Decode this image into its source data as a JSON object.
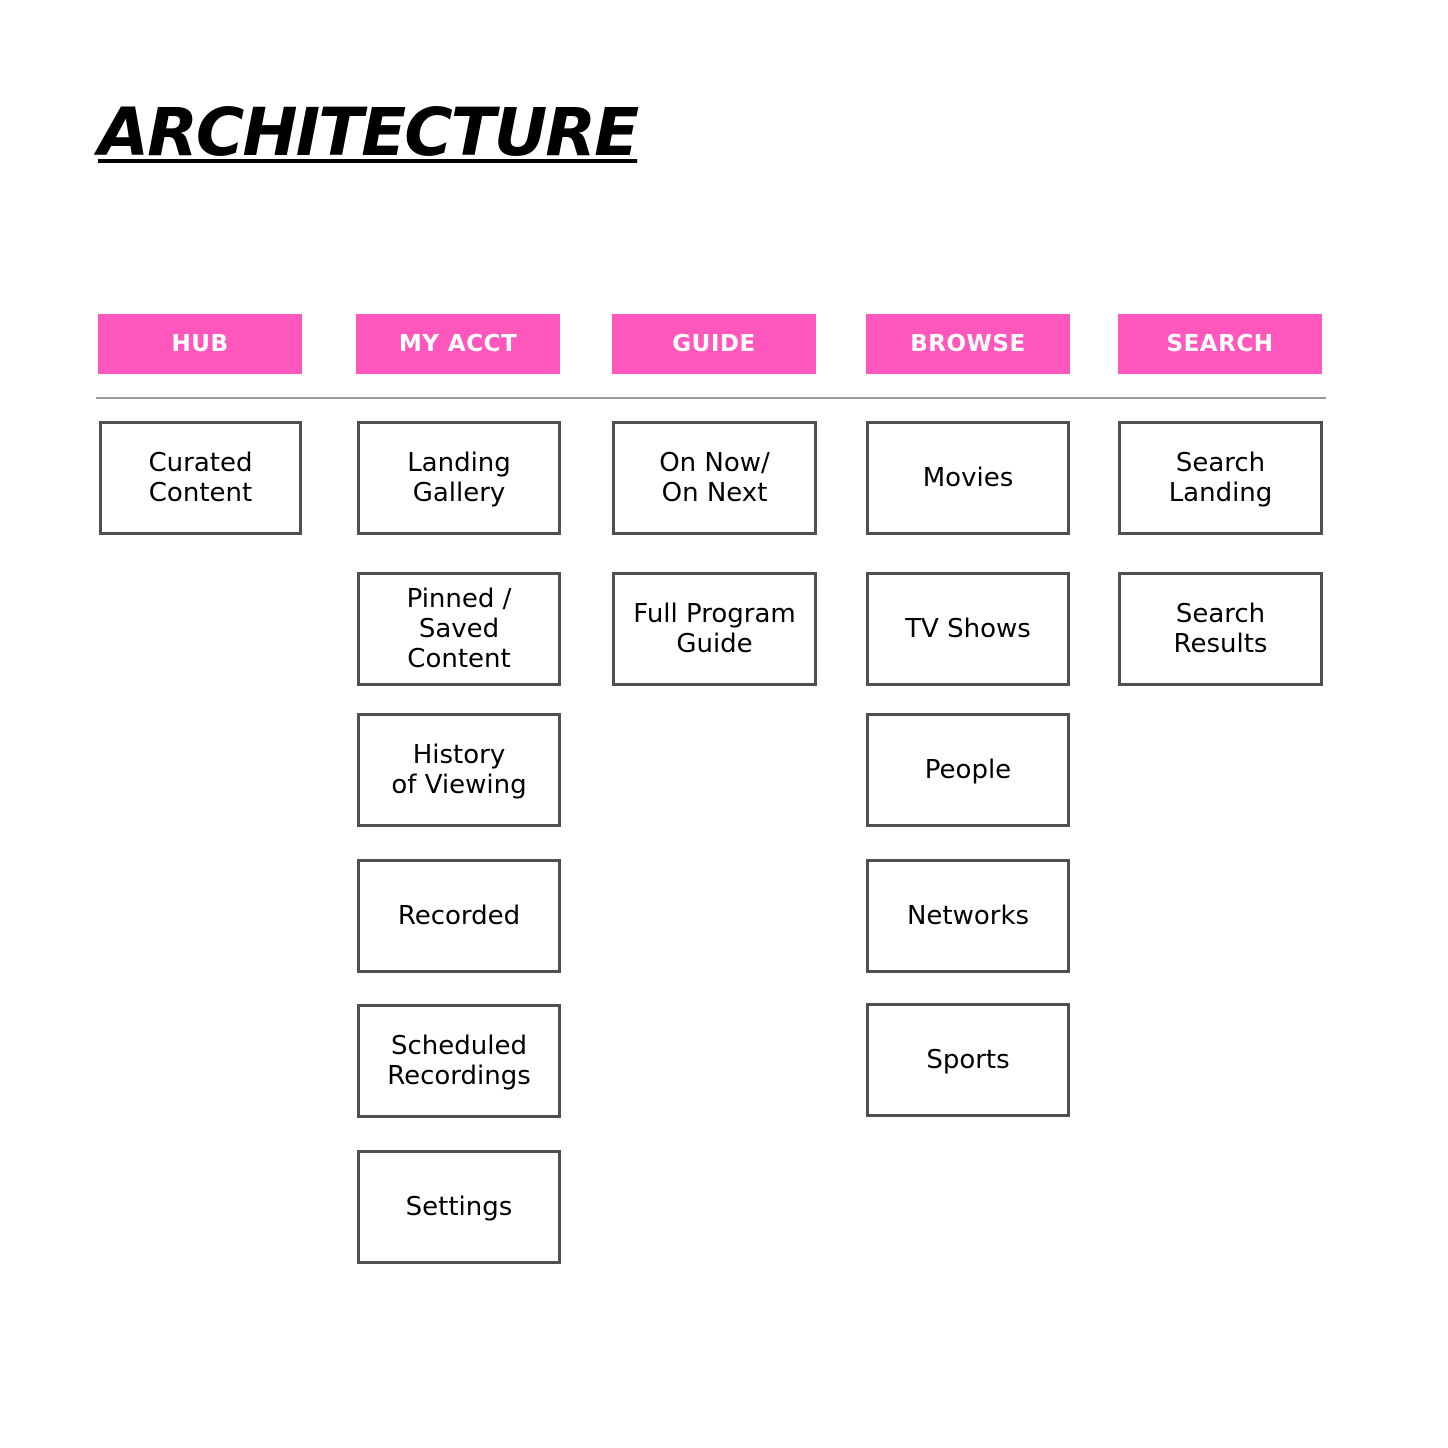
{
  "title": "ARCHITECTURE",
  "colors": {
    "header_bg": "#ff57bb",
    "header_text": "#ffffff",
    "box_border": "#4f4f4f",
    "divider": "#9a9a9a"
  },
  "columns": [
    {
      "header": "HUB",
      "items": [
        "Curated\nContent"
      ]
    },
    {
      "header": "MY ACCT",
      "items": [
        "Landing\nGallery",
        "Pinned /\nSaved\nContent",
        "History\nof Viewing",
        "Recorded",
        "Scheduled\nRecordings",
        "Settings"
      ]
    },
    {
      "header": "GUIDE",
      "items": [
        "On Now/\nOn Next",
        "Full Program\nGuide"
      ]
    },
    {
      "header": "BROWSE",
      "items": [
        "Movies",
        "TV Shows",
        "People",
        "Networks",
        "Sports"
      ]
    },
    {
      "header": "SEARCH",
      "items": [
        "Search\nLanding",
        "Search\nResults"
      ]
    }
  ]
}
